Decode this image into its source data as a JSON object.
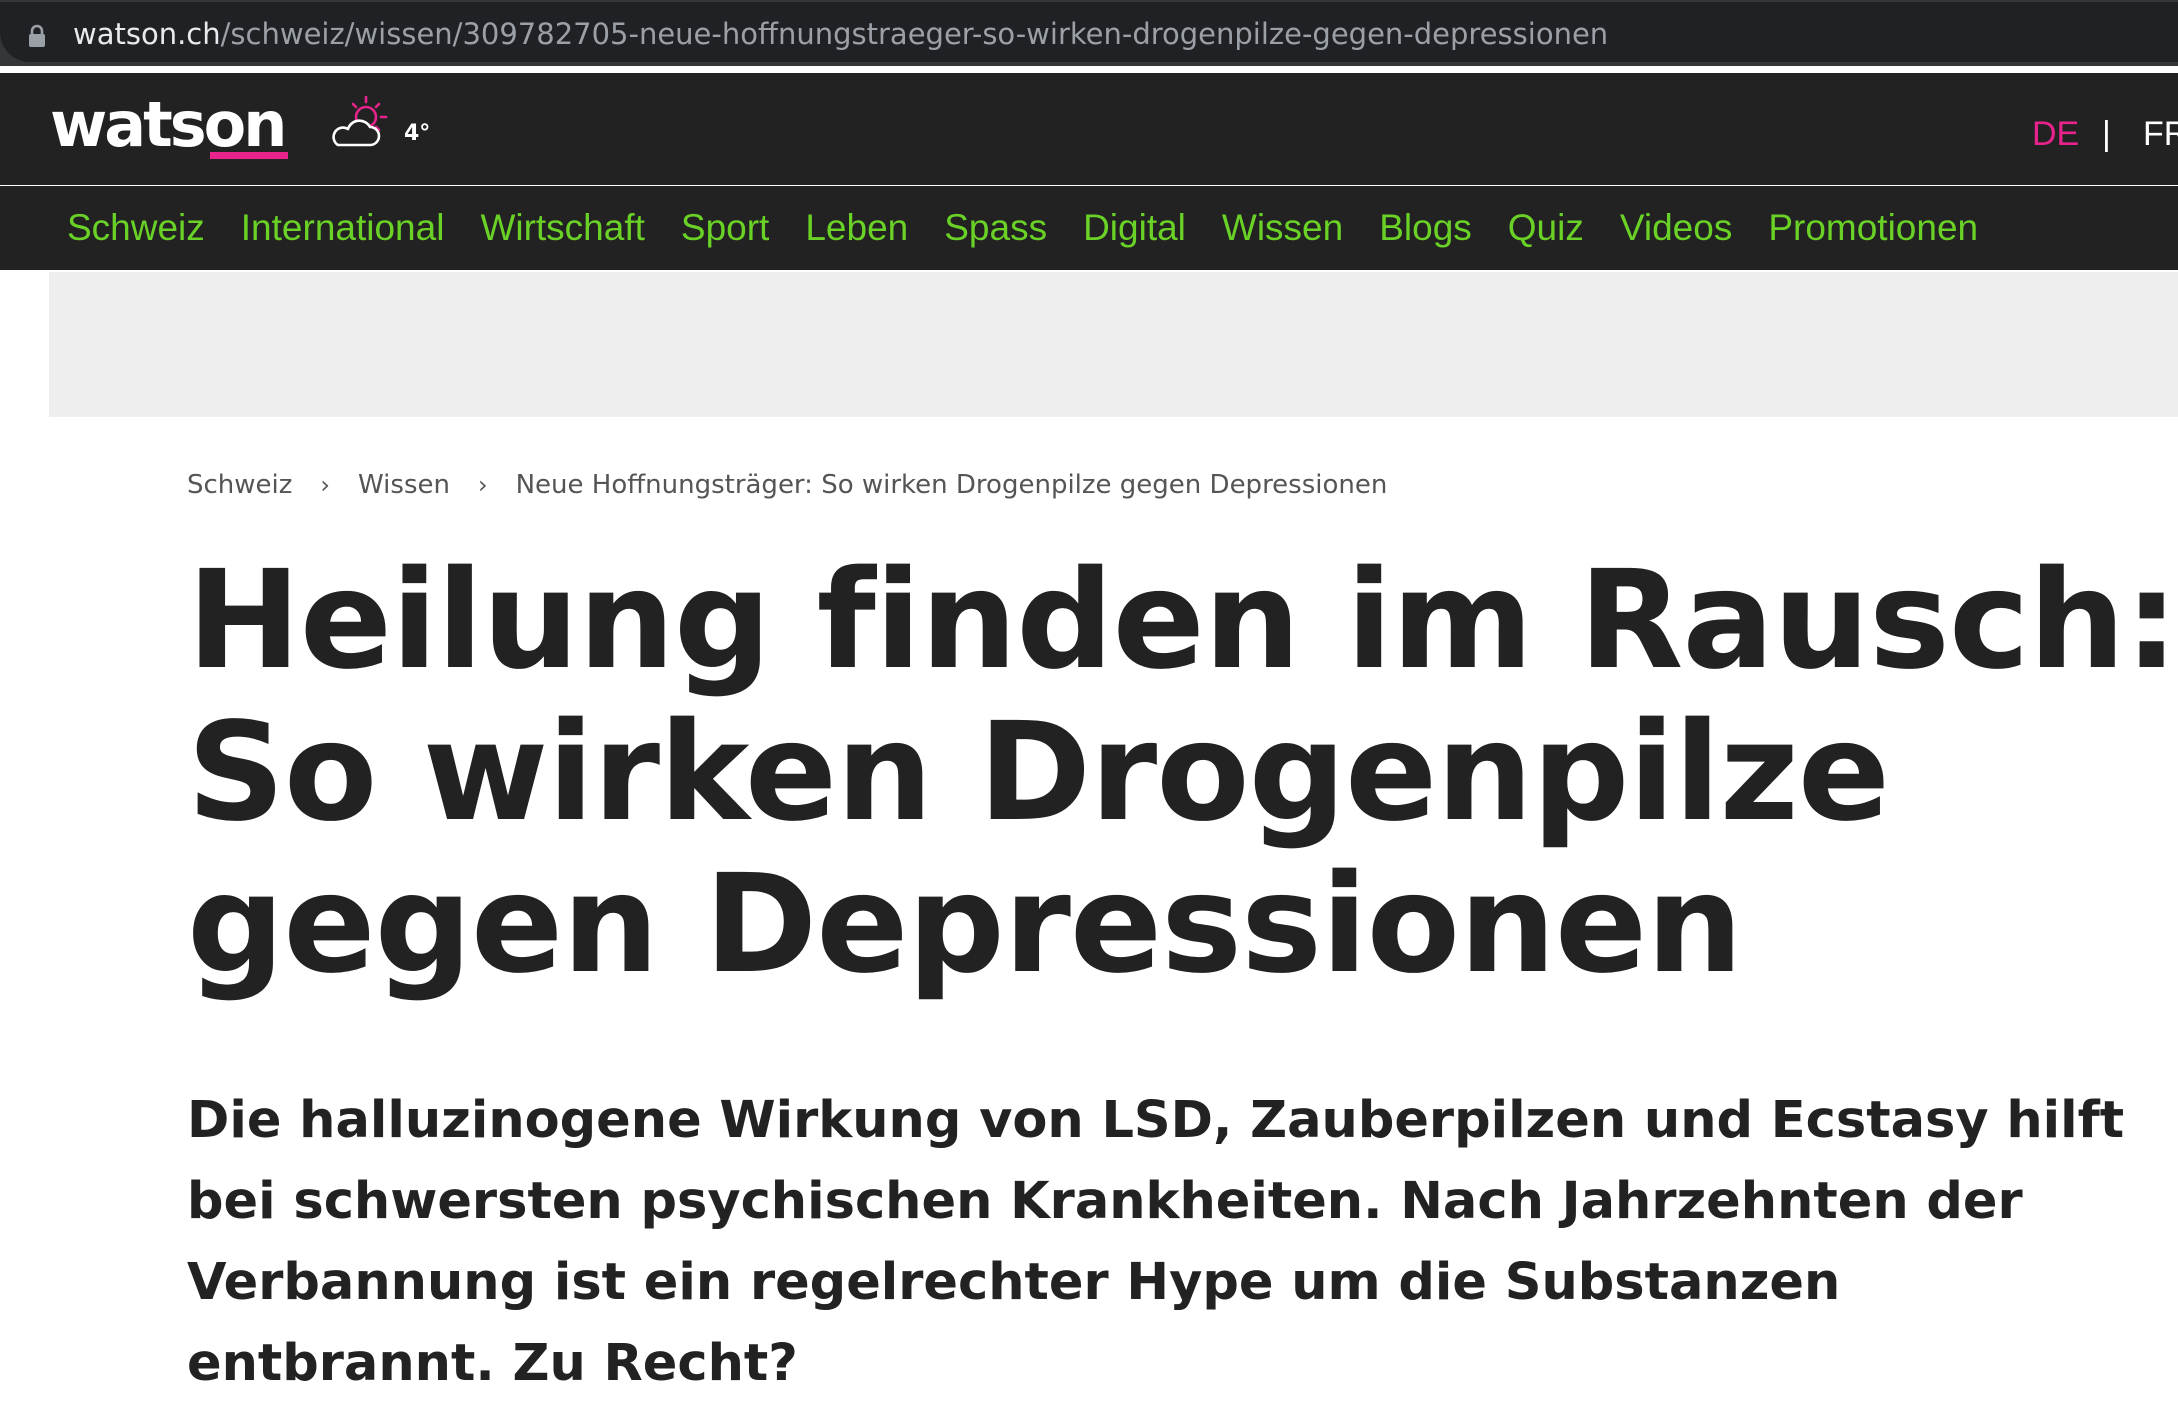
{
  "browser": {
    "url_domain": "watson.ch",
    "url_path": "/schweiz/wissen/309782705-neue-hoffnungstraeger-so-wirken-drogenpilze-gegen-depressionen",
    "lock_icon": "lock-icon"
  },
  "header": {
    "logo": "watson",
    "weather_icon": "sun-cloud-icon",
    "temperature": "4°",
    "languages": {
      "de": "DE",
      "separator": "|",
      "fr": "FR"
    },
    "colors": {
      "background": "#222222",
      "accent": "#e9238c"
    }
  },
  "nav": {
    "color": "#6ad226",
    "items": [
      "Schweiz",
      "International",
      "Wirtschaft",
      "Sport",
      "Leben",
      "Spass",
      "Digital",
      "Wissen",
      "Blogs",
      "Quiz",
      "Videos",
      "Promotionen"
    ]
  },
  "breadcrumb": {
    "items": [
      "Schweiz",
      "Wissen",
      "Neue Hoffnungsträger: So wirken Drogenpilze gegen Depressionen"
    ],
    "separator": "›"
  },
  "article": {
    "headline": "Heilung finden im Rausch: So wirken Drogenpilze gegen Depressionen",
    "lead": "Die halluzinogene Wirkung von LSD, Zauberpilzen und Ecstasy hilft bei schwersten psychischen Krankheiten. Nach Jahrzehnten der Verbannung ist ein regelrechter Hype um die Substanzen entbrannt. Zu Recht?"
  }
}
